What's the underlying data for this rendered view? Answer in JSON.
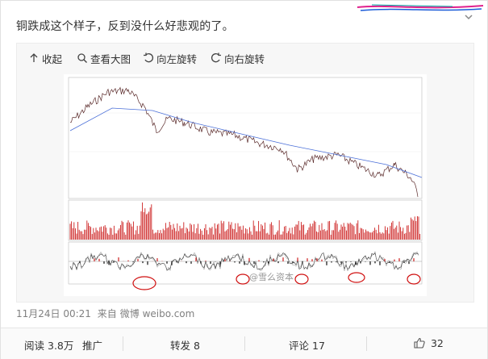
{
  "post": {
    "text": "铜跌成这个样子，反到没什么好悲观的了。"
  },
  "toolbar": {
    "collapse_label": "收起",
    "view_large_label": "查看大图",
    "rotate_left_label": "向左旋转",
    "rotate_right_label": "向右旋转"
  },
  "image": {
    "watermark": "@雪么资本"
  },
  "meta": {
    "time": "11月24日 00:21",
    "source_prefix": "来自",
    "source": "微博 weibo.com"
  },
  "actions": {
    "read_label": "阅读",
    "read_count": "3.8万",
    "promote_label": "推广",
    "repost_label": "转发",
    "repost_count": "8",
    "comment_label": "评论",
    "comment_count": "17",
    "like_count": "32"
  },
  "colors": {
    "price_line": "#5a2a2a",
    "ma_line": "#4a6fd8",
    "volume_bar": "#cc1f1f",
    "circle": "#d01010",
    "deco_pink": "#e0208c",
    "deco_blue": "#1a5bd8"
  },
  "icons": {
    "collapse": "arrow-up-icon",
    "view_large": "magnifier-icon",
    "rotate_left": "rotate-left-icon",
    "rotate_right": "rotate-right-icon",
    "like": "thumbs-up-icon",
    "menu": "chevron-down-icon"
  }
}
